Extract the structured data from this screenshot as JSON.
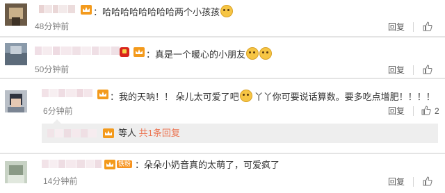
{
  "comments": [
    {
      "text_before": "：哈哈哈哈哈哈哈哈两个小孩孩",
      "time": "48分钟前",
      "reply_label": "回复",
      "like_count": "",
      "icons": [
        "blurred-avatar",
        "vip-crown-icon",
        "smiley-emoji"
      ]
    },
    {
      "text_before": "：真是一个暖心的小朋友",
      "time": "50分钟前",
      "reply_label": "回复",
      "like_count": "",
      "icons": [
        "blurred-avatar",
        "red-badge-icon",
        "vip-crown-icon",
        "laugh-emoji",
        "laugh-emoji"
      ]
    },
    {
      "text_before": "：我的天呐！！ 朵儿太可爱了吧",
      "text_after": "丫丫你可要说话算数。要多吃点增肥！！！！",
      "time": "6分钟前",
      "reply_label": "回复",
      "like_count": "2",
      "subreply": {
        "people_label": "等人",
        "link_label": "共1条回复"
      }
    },
    {
      "text_before": "：朵朵小奶音真的太萌了，可爱疯了",
      "fan_badge": "铁粉",
      "time": "14分钟前",
      "reply_label": "回复",
      "like_count": ""
    }
  ],
  "colors": {
    "accent": "#eb7350",
    "timestamp": "#808080",
    "divider": "#e4e4e4",
    "subreply_bg": "#eeeeee"
  }
}
